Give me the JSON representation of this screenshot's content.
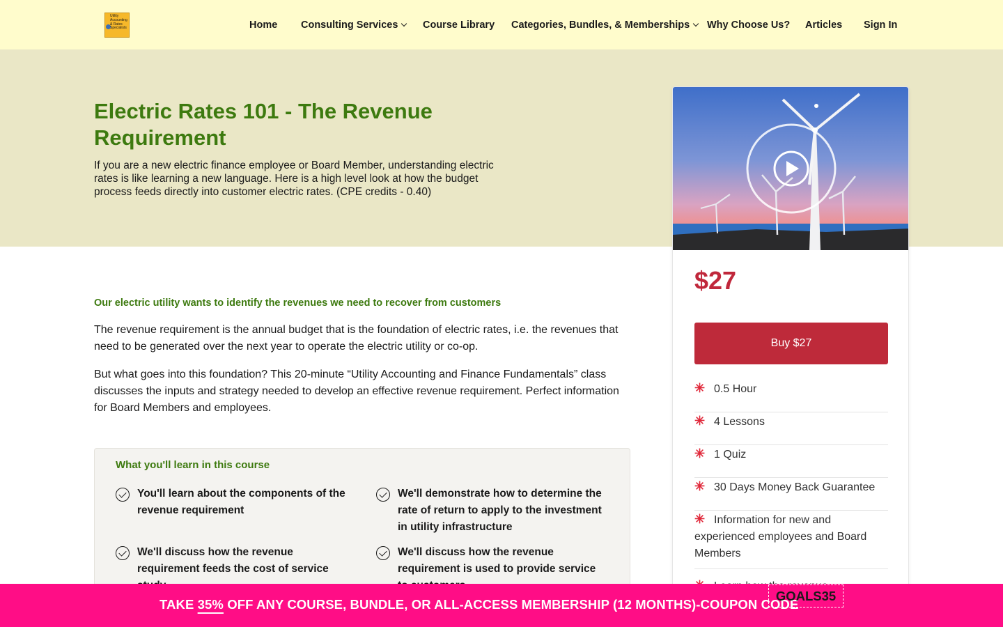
{
  "nav": {
    "logo_text": "Utility\nAccounting\n& Rates\nSpecialists",
    "items": [
      {
        "label": "Home"
      },
      {
        "label": "Consulting Services"
      },
      {
        "label": "Course Library"
      },
      {
        "label": "Categories, Bundles, & Memberships"
      },
      {
        "label": "Why Choose Us?"
      },
      {
        "label": "Articles"
      },
      {
        "label": "Sign In"
      }
    ]
  },
  "hero": {
    "title": "Electric Rates 101 - The Revenue Requirement",
    "description": "If you are a new electric finance employee or Board Member, understanding electric rates is like learning a new language. Here is a high level look at how the budget process feeds directly into customer electric rates. (CPE credits - 0.40)"
  },
  "main": {
    "subheading": "Our electric utility wants to identify the revenues we need to recover from customers",
    "paragraphs": [
      "The revenue requirement is the annual budget that is the foundation of electric rates, i.e. the revenues that need to be generated over the next year to operate the electric utility or co-op.",
      "But what goes into this foundation? This 20-minute “Utility Accounting and Finance Fundamentals” class discusses the inputs and strategy needed to develop an effective revenue requirement. Perfect information for Board Members and employees."
    ],
    "learn": {
      "title": "What you'll learn in this course",
      "items": [
        "You'll learn about the components of the revenue requirement",
        "We'll demonstrate how to determine the rate of return to apply to the investment in utility infrastructure",
        "We'll discuss how the revenue requirement feeds the cost of service study",
        "We'll discuss how the revenue requirement is used to provide service to customers"
      ]
    }
  },
  "card": {
    "price": "$27",
    "buy_label": "Buy $27",
    "features": [
      "0.5 Hour",
      "4 Lessons",
      "1 Quiz",
      "30 Days Money Back Guarantee",
      "Information for new and experienced employees and Board Members",
      "Learn how the revenue"
    ]
  },
  "promo": {
    "text_before": "TAKE ",
    "discount": "35%",
    "text_after": " OFF ANY COURSE, BUNDLE, OR ALL-ACCESS MEMBERSHIP (12 MONTHS)-COUPON CODE",
    "coupon_code": "GOALS35"
  },
  "colors": {
    "nav_bg": "#fffccc",
    "hero_bg": "#eae7c6",
    "accent_green": "#3d7a0f",
    "price_red": "#c0273b",
    "button_red": "#be2a3a",
    "promo_pink": "#ff0d86"
  },
  "icons": [
    "play-icon",
    "check-circle-icon",
    "asterisk-icon",
    "chevron-down-icon"
  ]
}
